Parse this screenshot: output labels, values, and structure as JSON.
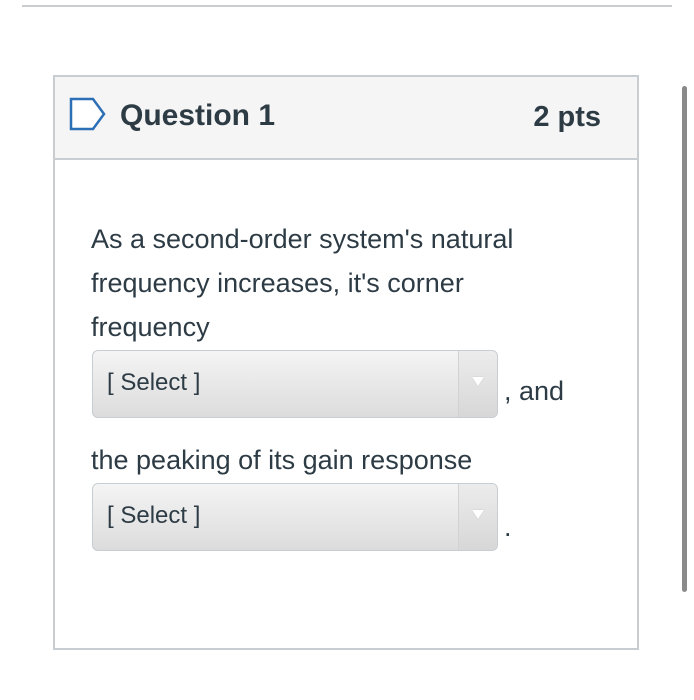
{
  "question": {
    "title": "Question 1",
    "points": "2 pts",
    "text_line1": "As a second-order system's natural",
    "text_line2": "frequency increases, it's corner",
    "text_line3": "frequency",
    "after_select1": ", and",
    "text_line4": "the peaking of its gain response",
    "after_select2": "."
  },
  "selects": [
    {
      "selected": "[ Select ]"
    },
    {
      "selected": "[ Select ]"
    }
  ],
  "icons": {
    "flag": "bookmark-flag-icon",
    "caret": "caret-down-icon"
  },
  "colors": {
    "text": "#2d3b45",
    "border": "#c7cdd1",
    "header_bg": "#f5f5f5"
  }
}
